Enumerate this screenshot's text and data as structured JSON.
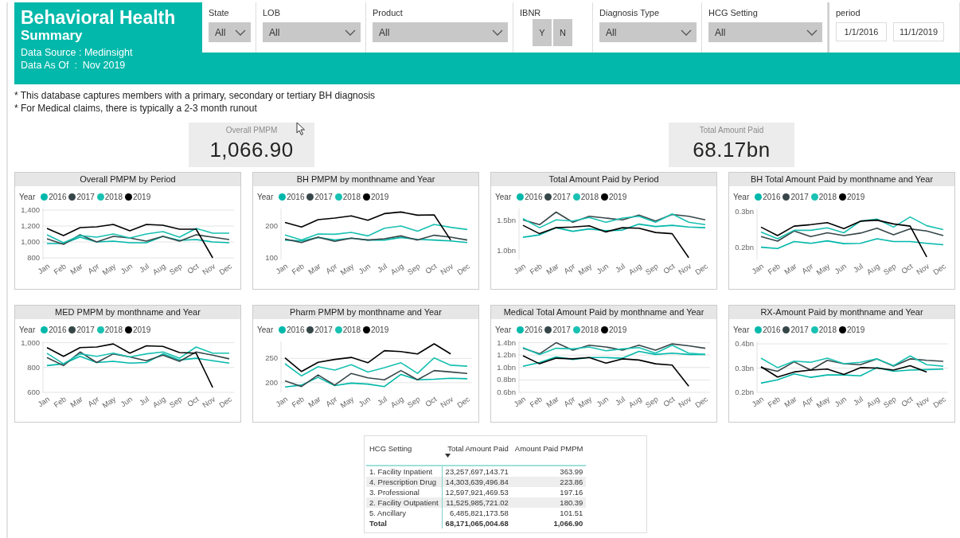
{
  "header": {
    "title": "Behavioral Health",
    "subtitle": "Summary",
    "source": "Data Source : Medinsight",
    "as_of": "Data As Of  :  Nov 2019"
  },
  "slicers": [
    {
      "kind": "dropdown",
      "label": "State",
      "value": "All"
    },
    {
      "kind": "dropdown",
      "label": "LOB",
      "value": "All"
    },
    {
      "kind": "dropdown",
      "label": "Product",
      "value": "All"
    },
    {
      "kind": "toggle",
      "label": "IBNR",
      "options": [
        "Y",
        "N"
      ]
    },
    {
      "kind": "dropdown",
      "label": "Diagnosis Type",
      "value": "All"
    },
    {
      "kind": "dropdown",
      "label": "HCG Setting",
      "value": "All"
    },
    {
      "kind": "date_range",
      "label": "period",
      "start": "1/1/2016",
      "end": "11/1/2019"
    }
  ],
  "notes": [
    "* This database captures members with a primary, secondary or tertiary BH diagnosis",
    "* For Medical claims, there is typically a 2-3 month runout"
  ],
  "kpis": [
    {
      "label": "Overall PMPM",
      "value": "1,066.90"
    },
    {
      "label": "Total Amount Paid",
      "value": "68.17bn"
    }
  ],
  "charts": [
    {
      "chart_data": {
        "type": "line",
        "title": "Overall PMPM by Period",
        "legend_title": "Year",
        "categories": [
          "Jan",
          "Feb",
          "Mar",
          "Apr",
          "May",
          "Jun",
          "Jul",
          "Aug",
          "Sep",
          "Oct",
          "Nov",
          "Dec"
        ],
        "grid": true,
        "ylim": [
          780,
          1420
        ],
        "yticks": [
          {
            "value": 800,
            "label": "800"
          },
          {
            "value": 1000,
            "label": "1,000"
          },
          {
            "value": 1200,
            "label": "1,200"
          },
          {
            "value": 1400,
            "label": "1,400"
          }
        ],
        "series": [
          {
            "name": "2016",
            "color": "#01b8aa",
            "values": [
              980,
              980,
              1060,
              1000,
              1010,
              990,
              990,
              1070,
              1020,
              1030,
              1000,
              990
            ]
          },
          {
            "name": "2017",
            "color": "#374649",
            "values": [
              1040,
              970,
              1090,
              1000,
              1070,
              1050,
              1010,
              1070,
              1010,
              1090,
              1060,
              1030
            ]
          },
          {
            "name": "2018",
            "color": "#19c1b2",
            "values": [
              1090,
              990,
              1080,
              1060,
              1100,
              1050,
              1100,
              1130,
              1060,
              1170,
              1110,
              1110
            ]
          },
          {
            "name": "2019",
            "color": "#000000",
            "values": [
              1170,
              1080,
              1180,
              1190,
              1220,
              1140,
              1220,
              1210,
              1160,
              1160,
              800,
              null
            ]
          }
        ]
      }
    },
    {
      "chart_data": {
        "type": "line",
        "title": "BH PMPM by monthname and Year",
        "legend_title": "Year",
        "categories": [
          "Jan",
          "Feb",
          "Mar",
          "Apr",
          "May",
          "Jun",
          "Jul",
          "Aug",
          "Sep",
          "Oct",
          "Nov",
          "Dec"
        ],
        "ylim": [
          95,
          255
        ],
        "yticks": [
          100,
          200
        ],
        "series": [
          {
            "name": "2016",
            "color": "#01b8aa",
            "values": [
              156,
              153,
              164,
              156,
              162,
              156,
              156,
              164,
              158,
              156,
              153,
              148
            ]
          },
          {
            "name": "2017",
            "color": "#374649",
            "values": [
              159,
              148,
              165,
              152,
              162,
              156,
              160,
              169,
              156,
              171,
              165,
              156
            ]
          },
          {
            "name": "2018",
            "color": "#19c1b2",
            "values": [
              172,
              156,
              175,
              174,
              180,
              169,
              193,
              200,
              184,
              205,
              196,
              189
            ]
          },
          {
            "name": "2019",
            "color": "#000000",
            "values": [
              211,
              197,
              220,
              225,
              232,
              218,
              239,
              244,
              234,
              235,
              156,
              null
            ]
          }
        ]
      }
    },
    {
      "chart_data": {
        "type": "line",
        "title": "Total Amount Paid by Period",
        "legend_title": "Year",
        "categories": [
          "Jan",
          "Feb",
          "Mar",
          "Apr",
          "May",
          "Jun",
          "Jul",
          "Aug",
          "Sep",
          "Oct",
          "Nov",
          "Dec"
        ],
        "ylim": [
          0.85,
          1.7
        ],
        "yticks": [
          {
            "value": 1.0,
            "label": "1.0bn"
          },
          {
            "value": 1.5,
            "label": "1.5bn"
          }
        ],
        "series": [
          {
            "name": "2016",
            "color": "#01b8aa",
            "values": [
              1.22,
              1.26,
              1.38,
              1.32,
              1.36,
              1.33,
              1.34,
              1.44,
              1.4,
              1.42,
              1.39,
              1.38
            ]
          },
          {
            "name": "2017",
            "color": "#374649",
            "values": [
              1.51,
              1.43,
              1.64,
              1.47,
              1.57,
              1.54,
              1.51,
              1.59,
              1.49,
              1.6,
              1.57,
              1.51
            ]
          },
          {
            "name": "2018",
            "color": "#19c1b2",
            "values": [
              1.53,
              1.38,
              1.51,
              1.49,
              1.55,
              1.47,
              1.54,
              1.57,
              1.47,
              1.61,
              1.47,
              1.43
            ]
          },
          {
            "name": "2019",
            "color": "#000000",
            "values": [
              1.42,
              1.28,
              1.38,
              1.39,
              1.41,
              1.31,
              1.38,
              1.37,
              1.3,
              1.28,
              0.88,
              null
            ]
          }
        ]
      }
    },
    {
      "chart_data": {
        "type": "line",
        "title": "BH Total Amount Paid by monthname and Year",
        "legend_title": "Year",
        "categories": [
          "Jan",
          "Feb",
          "Mar",
          "Apr",
          "May",
          "Jun",
          "Jul",
          "Aug",
          "Sep",
          "Oct",
          "Nov",
          "Dec"
        ],
        "ylim": [
          0.165,
          0.31
        ],
        "yticks": [
          {
            "value": 0.2,
            "label": "0.2bn"
          },
          {
            "value": 0.3,
            "label": "0.3bn"
          }
        ],
        "series": [
          {
            "name": "2016",
            "color": "#01b8aa",
            "values": [
              0.2,
              0.196,
              0.216,
              0.211,
              0.218,
              0.21,
              0.211,
              0.224,
              0.216,
              0.216,
              0.211,
              0.207
            ]
          },
          {
            "name": "2017",
            "color": "#374649",
            "values": [
              0.23,
              0.217,
              0.246,
              0.23,
              0.241,
              0.233,
              0.24,
              0.254,
              0.235,
              0.252,
              0.246,
              0.233
            ]
          },
          {
            "name": "2018",
            "color": "#19c1b2",
            "values": [
              0.243,
              0.224,
              0.248,
              0.248,
              0.255,
              0.241,
              0.274,
              0.28,
              0.257,
              0.286,
              0.261,
              0.25
            ]
          },
          {
            "name": "2019",
            "color": "#000000",
            "values": [
              0.257,
              0.233,
              0.26,
              0.264,
              0.27,
              0.253,
              0.274,
              0.277,
              0.266,
              0.26,
              0.172,
              null
            ]
          }
        ]
      }
    },
    {
      "chart_data": {
        "type": "line",
        "title": "MED PMPM by monthname and Year",
        "legend_title": "Year",
        "categories": [
          "Jan",
          "Feb",
          "Mar",
          "Apr",
          "May",
          "Jun",
          "Jul",
          "Aug",
          "Sep",
          "Oct",
          "Nov",
          "Dec"
        ],
        "grid": true,
        "ylim": [
          600,
          1010
        ],
        "yticks": [
          {
            "value": 600,
            "label": "600"
          },
          {
            "value": 800,
            "label": "800"
          },
          {
            "value": 1000,
            "label": "1,000"
          }
        ],
        "series": [
          {
            "name": "2016",
            "color": "#01b8aa",
            "values": [
              815,
              830,
              890,
              840,
              850,
              835,
              840,
              910,
              860,
              875,
              855,
              835
            ]
          },
          {
            "name": "2017",
            "color": "#374649",
            "values": [
              880,
              815,
              925,
              840,
              910,
              885,
              855,
              900,
              850,
              925,
              900,
              870
            ]
          },
          {
            "name": "2018",
            "color": "#19c1b2",
            "values": [
              915,
              830,
              910,
              890,
              915,
              885,
              910,
              925,
              875,
              965,
              915,
              915
            ]
          },
          {
            "name": "2019",
            "color": "#000000",
            "values": [
              960,
              890,
              960,
              965,
              990,
              915,
              975,
              970,
              920,
              915,
              640,
              null
            ]
          }
        ]
      }
    },
    {
      "chart_data": {
        "type": "line",
        "title": "Pharm PMPM by monthname and Year",
        "legend_title": "Year",
        "categories": [
          "Jan",
          "Feb",
          "Mar",
          "Apr",
          "May",
          "Jun",
          "Jul",
          "Aug",
          "Sep",
          "Oct",
          "Nov",
          "Dec"
        ],
        "grid": true,
        "ylim": [
          180,
          285
        ],
        "yticks": [
          200,
          250
        ],
        "series": [
          {
            "name": "2016",
            "color": "#01b8aa",
            "values": [
              191,
              195,
              211,
              194,
              199,
              197,
              192,
              217,
              206,
              207,
              209,
              208
            ]
          },
          {
            "name": "2017",
            "color": "#374649",
            "values": [
              204,
              192,
              216,
              195,
              219,
              210,
              206,
              225,
              206,
              225,
              222,
              219
            ]
          },
          {
            "name": "2018",
            "color": "#19c1b2",
            "values": [
              239,
              214,
              233,
              226,
              237,
              222,
              231,
              241,
              219,
              251,
              236,
              234
            ]
          },
          {
            "name": "2019",
            "color": "#000000",
            "values": [
              251,
              223,
              242,
              248,
              252,
              241,
              266,
              264,
              259,
              280,
              259,
              null
            ]
          }
        ]
      }
    },
    {
      "chart_data": {
        "type": "line",
        "title": "Medical Total Amount Paid by monthname and Year",
        "legend_title": "Year",
        "categories": [
          "Jan",
          "Feb",
          "Mar",
          "Apr",
          "May",
          "Jun",
          "Jul",
          "Aug",
          "Sep",
          "Oct",
          "Nov",
          "Dec"
        ],
        "grid": true,
        "ylim": [
          0.6,
          1.42
        ],
        "yticks": [
          {
            "value": 0.6,
            "label": "0.6bn"
          },
          {
            "value": 0.8,
            "label": "0.8bn"
          },
          {
            "value": 1.0,
            "label": "1.0bn"
          },
          {
            "value": 1.2,
            "label": "1.2bn"
          },
          {
            "value": 1.4,
            "label": "1.4bn"
          }
        ],
        "series": [
          {
            "name": "2016",
            "color": "#01b8aa",
            "values": [
              1.02,
              1.08,
              1.17,
              1.13,
              1.16,
              1.16,
              1.15,
              1.26,
              1.21,
              1.23,
              1.21,
              1.21
            ]
          },
          {
            "name": "2017",
            "color": "#374649",
            "values": [
              1.31,
              1.22,
              1.4,
              1.28,
              1.36,
              1.33,
              1.28,
              1.36,
              1.28,
              1.38,
              1.35,
              1.31
            ]
          },
          {
            "name": "2018",
            "color": "#19c1b2",
            "values": [
              1.32,
              1.21,
              1.31,
              1.3,
              1.33,
              1.27,
              1.3,
              1.32,
              1.23,
              1.36,
              1.23,
              1.21
            ]
          },
          {
            "name": "2019",
            "color": "#000000",
            "values": [
              1.19,
              1.06,
              1.15,
              1.14,
              1.16,
              1.07,
              1.14,
              1.12,
              1.06,
              1.04,
              0.7,
              null
            ]
          }
        ]
      }
    },
    {
      "chart_data": {
        "type": "line",
        "title": "RX-Amount Paid by monthname and Year",
        "legend_title": "Year",
        "categories": [
          "Jan",
          "Feb",
          "Mar",
          "Apr",
          "May",
          "Jun",
          "Jul",
          "Aug",
          "Sep",
          "Oct",
          "Nov",
          "Dec"
        ],
        "grid": true,
        "ylim": [
          0.2,
          0.41
        ],
        "yticks": [
          {
            "value": 0.2,
            "label": "0.2bn"
          },
          {
            "value": 0.3,
            "label": "0.3bn"
          },
          {
            "value": 0.4,
            "label": "0.4bn"
          }
        ],
        "series": [
          {
            "name": "2016",
            "color": "#01b8aa",
            "values": [
              0.238,
              0.252,
              0.276,
              0.262,
              0.272,
              0.272,
              0.268,
              0.302,
              0.287,
              0.292,
              0.294,
              0.296
            ]
          },
          {
            "name": "2017",
            "color": "#374649",
            "values": [
              0.302,
              0.287,
              0.326,
              0.292,
              0.332,
              0.318,
              0.314,
              0.338,
              0.308,
              0.338,
              0.332,
              0.328
            ]
          },
          {
            "name": "2018",
            "color": "#19c1b2",
            "values": [
              0.341,
              0.302,
              0.329,
              0.324,
              0.341,
              0.318,
              0.324,
              0.338,
              0.31,
              0.35,
              0.314,
              0.308
            ]
          },
          {
            "name": "2019",
            "color": "#000000",
            "values": [
              0.306,
              0.263,
              0.284,
              0.292,
              0.296,
              0.274,
              0.302,
              0.3,
              0.292,
              0.31,
              0.284,
              null
            ]
          }
        ]
      }
    }
  ],
  "table": {
    "columns": [
      {
        "label": "HCG Setting",
        "sorted": false
      },
      {
        "label": "Total Amount Paid",
        "sorted": true
      },
      {
        "label": "Amount Paid PMPM",
        "sorted": false
      }
    ],
    "rows": [
      [
        "1. Facility Inpatient",
        "23,257,697,143.71",
        "363.99"
      ],
      [
        "4. Prescription Drug",
        "14,303,639,496.84",
        "223.86"
      ],
      [
        "3. Professional",
        "12,597,921,469.53",
        "197.16"
      ],
      [
        "2. Facility Outpatient",
        "11,525,985,721.02",
        "180.39"
      ],
      [
        "5. Ancillary",
        "6,485,821,173.58",
        "101.51"
      ]
    ],
    "total": [
      "Total",
      "68,171,065,004.68",
      "1,066.90"
    ]
  }
}
